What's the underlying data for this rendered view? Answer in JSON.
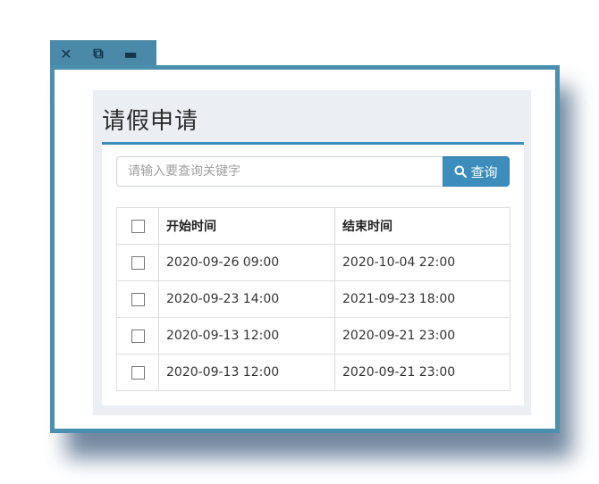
{
  "window": {
    "controls": [
      {
        "glyph": "✕",
        "name": "close"
      },
      {
        "glyph": "⧉",
        "name": "restore"
      },
      {
        "glyph": "▬",
        "name": "minimize"
      }
    ]
  },
  "page": {
    "title": "请假申请"
  },
  "search": {
    "placeholder": "请输入要查询关键字",
    "button_label": "查询",
    "icon": "search-icon"
  },
  "table": {
    "headers": [
      "开始时间",
      "结束时间"
    ],
    "rows": [
      {
        "start": "2020-09-26 09:00",
        "end": "2020-10-04 22:00"
      },
      {
        "start": "2020-09-23 14:00",
        "end": "2021-09-23 18:00"
      },
      {
        "start": "2020-09-13 12:00",
        "end": "2020-09-21 23:00"
      },
      {
        "start": "2020-09-13 12:00",
        "end": "2020-09-21 23:00"
      }
    ]
  },
  "colors": {
    "titlebar": "#4a8aa8",
    "frame_border": "#4b8fae",
    "accent": "#3c8dbc",
    "panel_bg": "#ebeef3"
  }
}
